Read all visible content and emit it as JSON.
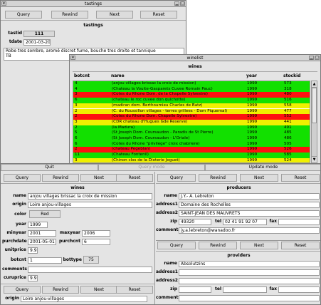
{
  "tastings": {
    "title": "tastings",
    "buttons": {
      "query": "Query",
      "rewind": "Rewind",
      "next": "Next",
      "reset": "Reset"
    },
    "header": "tastings",
    "fields": {
      "tastid_label": "tastid",
      "tastid_value": "111",
      "tdate_label": "tdate",
      "tdate_value": "2001-03-20"
    },
    "notes": [
      "Robe tres sombre, aromé discret fume, bouche tres droite et tannique",
      "TB"
    ]
  },
  "winelist": {
    "title": "winelist",
    "header": "wines",
    "columns": [
      "botcnt",
      "name",
      "year",
      "stockid"
    ],
    "rows": [
      {
        "botcnt": "4",
        "name": "(anjou villages brissac la croix de mission)",
        "year": "1999",
        "stockid": "573",
        "color": "#12e000"
      },
      {
        "botcnt": "4",
        "name": "(Chateau la Vouite-Gasparets Cuvee Romain Pauc)",
        "year": "1999",
        "stockid": "318",
        "color": "#12e000"
      },
      {
        "botcnt": "3",
        "name": "(Cotes du Rhone Dom. de la Chapelle Sylvestre)",
        "year": "1999",
        "stockid": "480",
        "color": "#ff1010"
      },
      {
        "botcnt": "6",
        "name": "(chateau le roc cuvee don quichotte)",
        "year": "1999",
        "stockid": "516",
        "color": "#12e000"
      },
      {
        "botcnt": "3",
        "name": "(madiran dom. Berthoumieu Charles de Batz)",
        "year": "1999",
        "stockid": "558",
        "color": "#f0f000"
      },
      {
        "botcnt": "2",
        "name": "(C. du Roussillon villages - terres grillees - Dom Piquemal)",
        "year": "1999",
        "stockid": "477",
        "color": "#f0f000"
      },
      {
        "botcnt": "2",
        "name": "(Cotes du Rhone Dom. Chapelle Sylvestre)",
        "year": "1999",
        "stockid": "552",
        "color": "#ff1010"
      },
      {
        "botcnt": "3",
        "name": "(CDR chateau d'Hugues Gde Reserve)",
        "year": "1999",
        "stockid": "441",
        "color": "#f0f000"
      },
      {
        "botcnt": "2",
        "name": "(la Madura)",
        "year": "1999",
        "stockid": "491",
        "color": "#12e000"
      },
      {
        "botcnt": "5",
        "name": "(St Joseph Dom. Coursaudon - Paradis de St Pierre)",
        "year": "1999",
        "stockid": "485",
        "color": "#12e000"
      },
      {
        "botcnt": "6",
        "name": "(St Joseph Dom. Coursaudon - L'Oriale)",
        "year": "1999",
        "stockid": "486",
        "color": "#12e000"
      },
      {
        "botcnt": "6",
        "name": "(Cotes du Rhone \"privilege\" croix chabriere)",
        "year": "1999",
        "stockid": "505",
        "color": "#12e000"
      },
      {
        "botcnt": "2",
        "name": "(chateau Pegeblan)",
        "year": "1999",
        "stockid": "526",
        "color": "#ff1010"
      },
      {
        "botcnt": "11",
        "name": "(Chateau Fontenil)",
        "year": "1999",
        "stockid": "585",
        "color": "#12e000"
      },
      {
        "botcnt": "3",
        "name": "(Chinon clos de la Dioterie Joguet)",
        "year": "1999",
        "stockid": "524",
        "color": "#f0f000"
      }
    ]
  },
  "wines_form": {
    "mode_buttons": {
      "quit": "Quit",
      "query_mode": "Query mode",
      "update_mode": "Update mode"
    },
    "buttons": {
      "query": "Query",
      "rewind": "Rewind",
      "next": "Next",
      "reset": "Reset"
    },
    "header": "wines",
    "name_label": "name",
    "name_value": "anjou villages brissac la croix de mission",
    "origin_label": "origin",
    "origin_value": "Loire anjou-villages",
    "color_label": "color",
    "color_value": "Red",
    "year_label": "year",
    "year_value": "1999",
    "minyear_label": "minyear",
    "minyear_value": "2001",
    "maxyear_label": "maxyear",
    "maxyear_value": "2006",
    "purchdate_label": "purchdate",
    "purchdate_value": "2001-05-01",
    "purchcnt_label": "purchcnt",
    "purchcnt_value": "6",
    "unitprice_label": "unitprice",
    "unitprice_value": "9.91",
    "botcnt_label": "botcnt",
    "botcnt_value": "1",
    "bottype_label": "bottype",
    "bottype_value": "75",
    "comments_label": "comments",
    "comments_value": "",
    "curuprice_label": "curuprice",
    "curuprice_value": "9.91",
    "bottom_buttons": {
      "query": "Query",
      "rewind": "Rewind",
      "next": "Next",
      "reset": "Reset"
    },
    "bottom_origin_label": "origin",
    "bottom_origin_value": "Loire anjou-villages"
  },
  "producers": {
    "buttons": {
      "query": "Query",
      "rewind": "Rewind",
      "next": "Next",
      "reset": "Reset"
    },
    "header": "producers",
    "name_label": "name",
    "name_value": "J.Y.- A. Lebreton",
    "address1_label": "address1",
    "address1_value": "Domaine des Rochelles",
    "address2_label": "address2",
    "address2_value": "SAINT-JEAN DES MAUVRETS",
    "zip_label": "zip",
    "zip_value": "49320",
    "tel_label": "tel",
    "tel_value": "02 41 91 92 07",
    "fax_label": "fax",
    "fax_value": "",
    "comments_label": "comments",
    "comments_value": "jy.a.lebreton@wanadoo.fr"
  },
  "providers": {
    "buttons": {
      "query": "Query",
      "rewind": "Rewind",
      "next": "Next",
      "reset": "Reset"
    },
    "header": "providers",
    "name_label": "name",
    "name_value": "Absolutzins",
    "address1_label": "address1",
    "address1_value": "",
    "address2_label": "address2",
    "address2_value": "",
    "zip_label": "zip",
    "zip_value": "",
    "tel_label": "tel",
    "tel_value": "",
    "fax_label": "fax",
    "fax_value": "",
    "comments_label": "comments",
    "comments_value": ""
  }
}
